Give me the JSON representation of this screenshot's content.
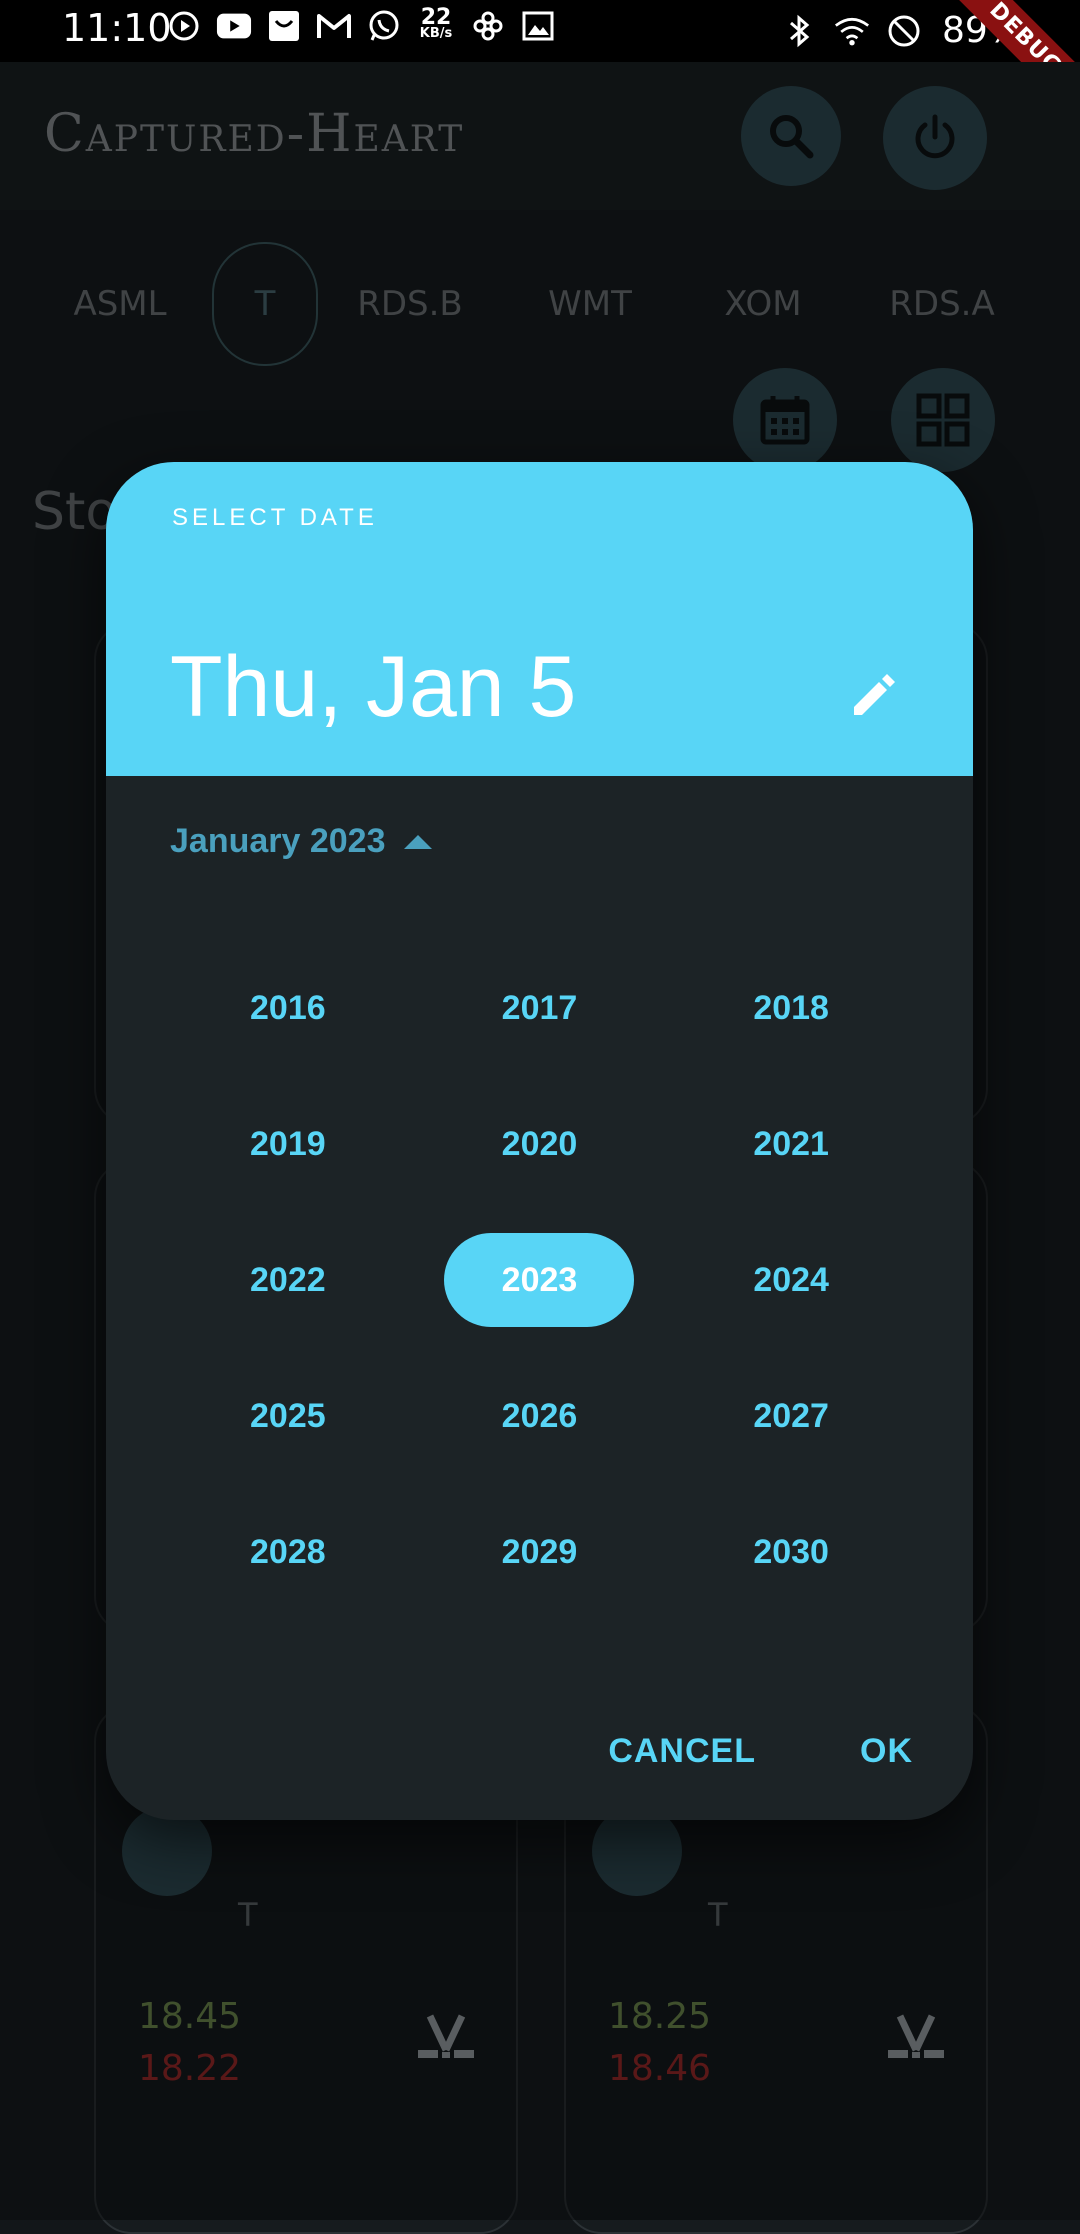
{
  "status_bar": {
    "time": "11:10",
    "net_speed_value": "22",
    "net_speed_unit": "KB/s",
    "battery": "89%",
    "debug_label": "DEBUG"
  },
  "app": {
    "title": "Captured-Heart",
    "tabs": [
      {
        "label": "ASML"
      },
      {
        "label": "T"
      },
      {
        "label": "RDS.B"
      },
      {
        "label": "WMT"
      },
      {
        "label": "XOM"
      },
      {
        "label": "RDS.A"
      }
    ],
    "active_tab": "T",
    "section_title": "Sto",
    "cards": [
      {
        "ticker": "T",
        "price_up": "18.45",
        "price_down": "18.22"
      },
      {
        "ticker": "T",
        "price_up": "18.25",
        "price_down": "18.46"
      }
    ]
  },
  "date_picker": {
    "help_text": "SELECT DATE",
    "selected_date": "Thu, Jan 5",
    "month_year": "January 2023",
    "years": [
      "2016",
      "2017",
      "2018",
      "2019",
      "2020",
      "2021",
      "2022",
      "2023",
      "2024",
      "2025",
      "2026",
      "2027",
      "2028",
      "2029",
      "2030"
    ],
    "selected_year": "2023",
    "cancel_label": "CANCEL",
    "ok_label": "OK"
  },
  "colors": {
    "accent": "#58d5f6",
    "background": "#171c1f",
    "dialog": "#1c2326",
    "price_up": "#6f8b4f",
    "price_down": "#9b2a2a"
  }
}
